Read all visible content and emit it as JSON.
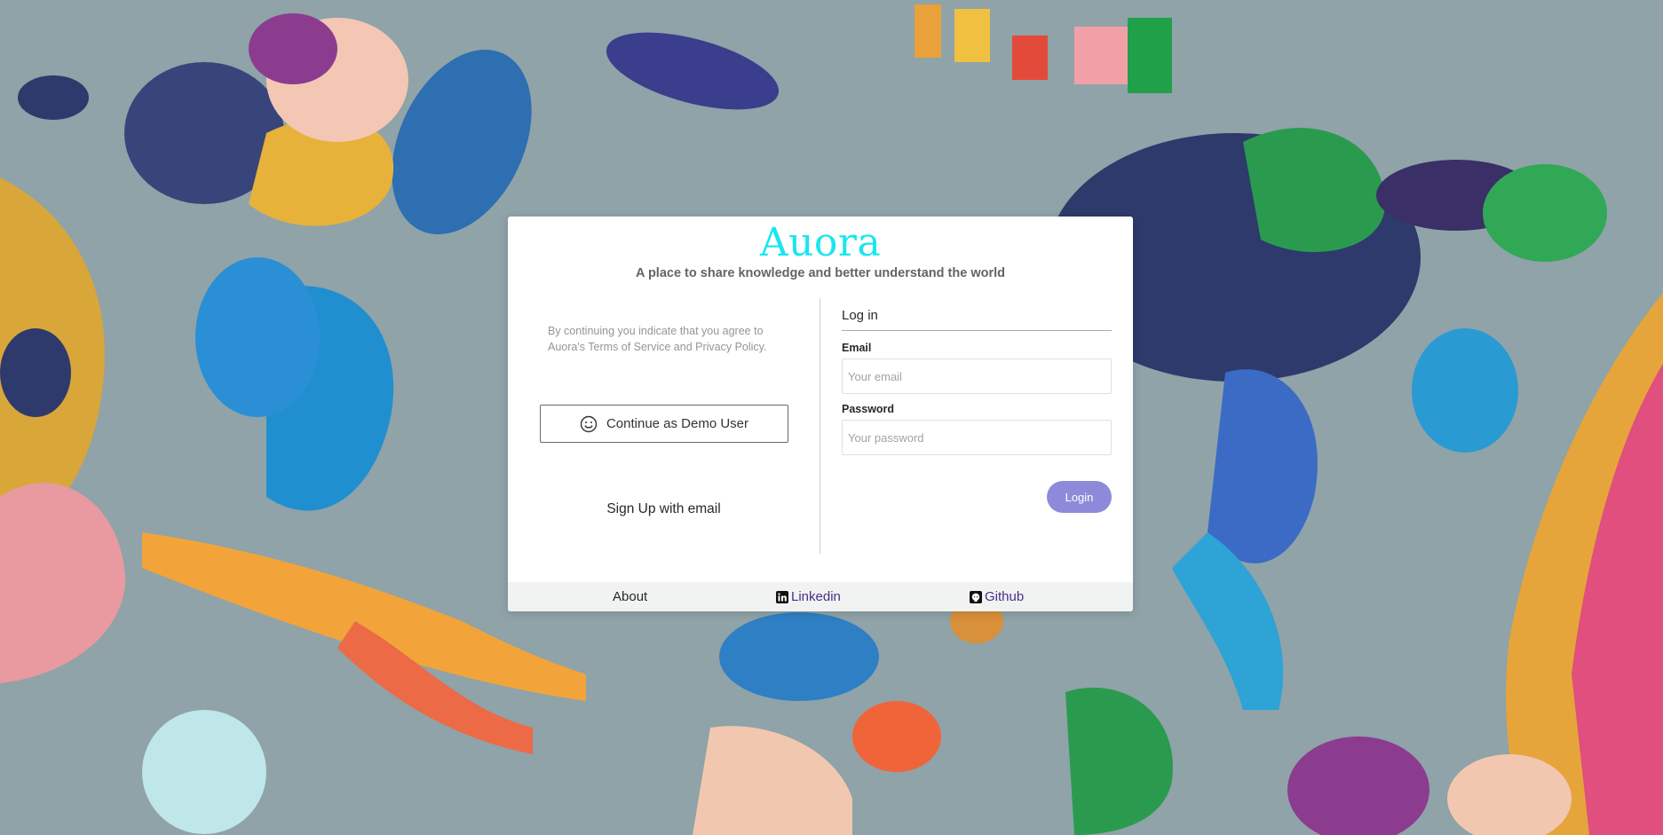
{
  "brand": {
    "title": "Auora",
    "tagline": "A place to share knowledge and better understand the world",
    "accent_color": "#19e6f0"
  },
  "left_panel": {
    "terms_text": "By continuing you indicate that you agree to Auora's Terms of Service and Privacy Policy.",
    "demo_button_label": "Continue as Demo User",
    "demo_icon": "smile-icon",
    "signup_label": "Sign Up with email"
  },
  "login": {
    "heading": "Log in",
    "email_label": "Email",
    "email_placeholder": "Your email",
    "email_value": "",
    "password_label": "Password",
    "password_placeholder": "Your password",
    "password_value": "",
    "submit_label": "Login",
    "submit_color": "#8d8bd9"
  },
  "footer": {
    "about_label": "About",
    "linkedin_label": "Linkedin",
    "linkedin_icon": "linkedin-icon",
    "github_label": "Github",
    "github_icon": "github-icon"
  }
}
